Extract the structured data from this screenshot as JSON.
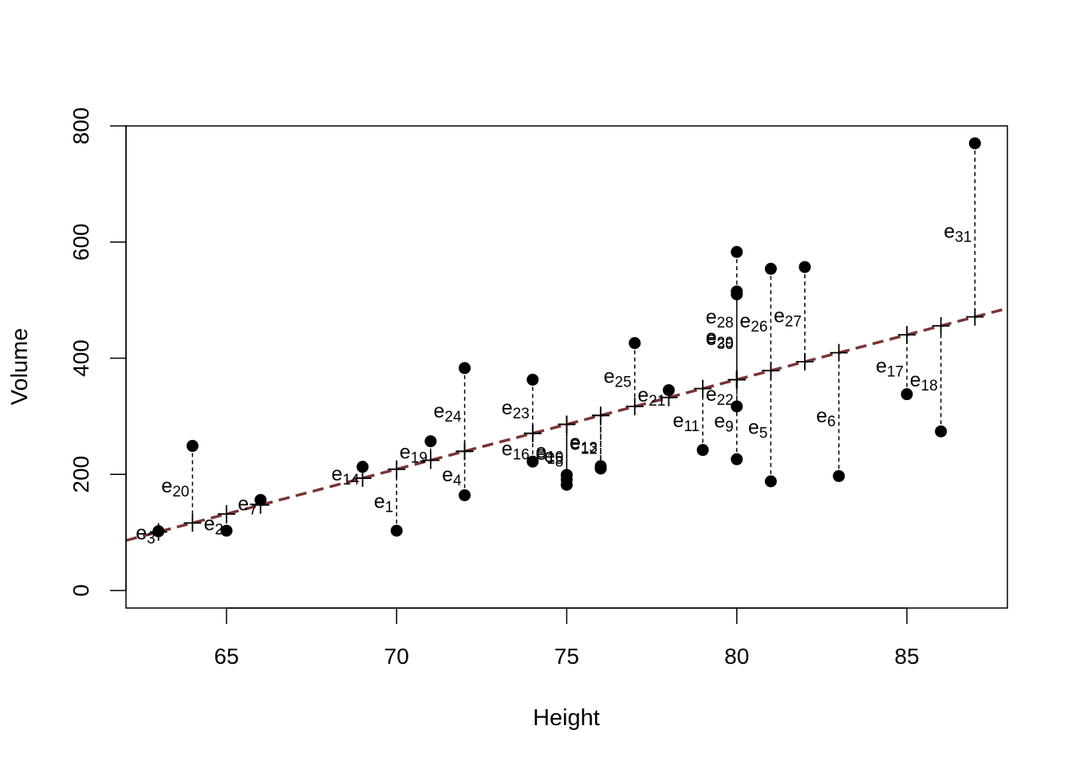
{
  "chart_data": {
    "type": "scatter",
    "title": "",
    "xlabel": "Height",
    "ylabel": "Volume",
    "xlim": [
      62.05,
      87.95
    ],
    "ylim": [
      -30,
      800
    ],
    "x_ticks": [
      65,
      70,
      75,
      80,
      85
    ],
    "y_ticks": [
      0,
      200,
      400,
      600,
      800
    ],
    "grid": false,
    "label_base": "e",
    "regression_line": {
      "intercept": -871.24,
      "slope": 15.43,
      "color": "#7b3434",
      "style": "dashed"
    },
    "residual_style": "dashed",
    "fitted_marker": "plus",
    "points": [
      {
        "x": 70,
        "y": 103,
        "label": "1"
      },
      {
        "x": 65,
        "y": 103,
        "label": "2"
      },
      {
        "x": 63,
        "y": 102,
        "label": "3"
      },
      {
        "x": 72,
        "y": 164,
        "label": "4"
      },
      {
        "x": 81,
        "y": 188,
        "label": "5"
      },
      {
        "x": 83,
        "y": 197,
        "label": "6"
      },
      {
        "x": 66,
        "y": 156,
        "label": "7"
      },
      {
        "x": 75,
        "y": 182,
        "label": "8"
      },
      {
        "x": 80,
        "y": 226,
        "label": "9"
      },
      {
        "x": 75,
        "y": 199,
        "label": "10"
      },
      {
        "x": 79,
        "y": 242,
        "label": "11"
      },
      {
        "x": 76,
        "y": 210,
        "label": "12"
      },
      {
        "x": 76,
        "y": 214,
        "label": "13"
      },
      {
        "x": 69,
        "y": 213,
        "label": "14"
      },
      {
        "x": 75,
        "y": 191,
        "label": "15"
      },
      {
        "x": 74,
        "y": 222,
        "label": "16"
      },
      {
        "x": 85,
        "y": 338,
        "label": "17"
      },
      {
        "x": 86,
        "y": 274,
        "label": "18"
      },
      {
        "x": 71,
        "y": 257,
        "label": "19"
      },
      {
        "x": 64,
        "y": 249,
        "label": "20"
      },
      {
        "x": 78,
        "y": 345,
        "label": "21"
      },
      {
        "x": 80,
        "y": 317,
        "label": "22"
      },
      {
        "x": 74,
        "y": 363,
        "label": "23"
      },
      {
        "x": 72,
        "y": 383,
        "label": "24"
      },
      {
        "x": 77,
        "y": 426,
        "label": "25"
      },
      {
        "x": 81,
        "y": 554,
        "label": "26"
      },
      {
        "x": 82,
        "y": 557,
        "label": "27"
      },
      {
        "x": 80,
        "y": 583,
        "label": "28"
      },
      {
        "x": 80,
        "y": 515,
        "label": "29"
      },
      {
        "x": 80,
        "y": 510,
        "label": "30"
      },
      {
        "x": 87,
        "y": 770,
        "label": "31"
      }
    ]
  }
}
